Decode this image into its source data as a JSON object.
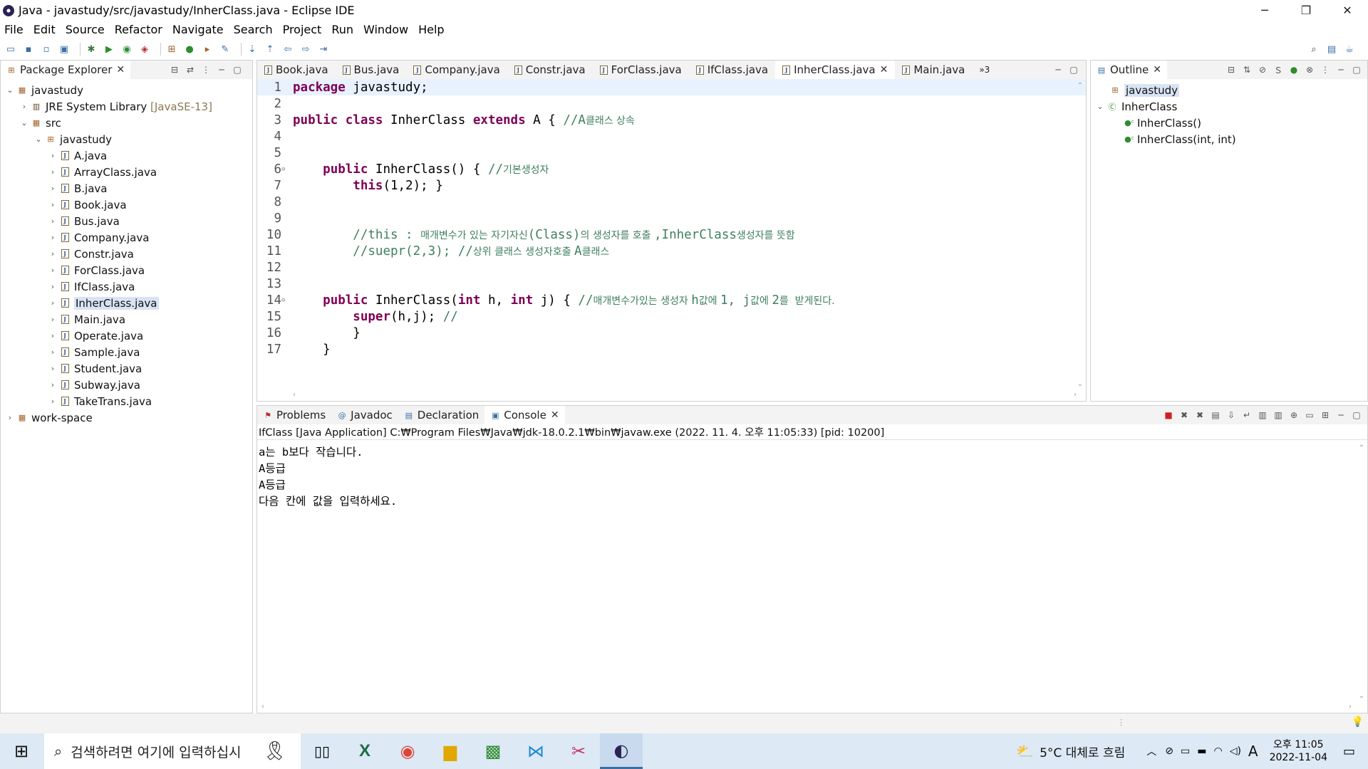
{
  "window": {
    "title": "Java - javastudy/src/javastudy/InherClass.java - Eclipse IDE",
    "minimize": "─",
    "restore": "❐",
    "close": "✕"
  },
  "menu": [
    "File",
    "Edit",
    "Source",
    "Refactor",
    "Navigate",
    "Search",
    "Project",
    "Run",
    "Window",
    "Help"
  ],
  "package_explorer": {
    "title": "Package Explorer",
    "project": "javastudy",
    "jre_label": "JRE System Library",
    "jre_version": "[JavaSE-13]",
    "src": "src",
    "package": "javastudy",
    "files": [
      "A.java",
      "ArrayClass.java",
      "B.java",
      "Book.java",
      "Bus.java",
      "Company.java",
      "Constr.java",
      "ForClass.java",
      "IfClass.java",
      "InherClass.java",
      "Main.java",
      "Operate.java",
      "Sample.java",
      "Student.java",
      "Subway.java",
      "TakeTrans.java"
    ],
    "selected_file": "InherClass.java",
    "other_project": "work-space"
  },
  "editor": {
    "tabs": [
      "Book.java",
      "Bus.java",
      "Company.java",
      "Constr.java",
      "ForClass.java",
      "IfClass.java",
      "InherClass.java",
      "Main.java"
    ],
    "active_tab": "InherClass.java",
    "overflow": "»3",
    "lines": [
      {
        "n": "1",
        "t": "package javastudy;"
      },
      {
        "n": "2",
        "t": ""
      },
      {
        "n": "3",
        "t": "public class InherClass extends A { //A클래스 상속"
      },
      {
        "n": "4",
        "t": ""
      },
      {
        "n": "5",
        "t": ""
      },
      {
        "n": "6",
        "t": "    public InherClass() { //기본생성자"
      },
      {
        "n": "7",
        "t": "        this(1,2); }"
      },
      {
        "n": "8",
        "t": ""
      },
      {
        "n": "9",
        "t": ""
      },
      {
        "n": "10",
        "t": "        //this : 매개변수가 있는 자기자신(Class)의 생성자를 호출 ,InherClass생성자를 뜻함"
      },
      {
        "n": "11",
        "t": "        //suepr(2,3); //상위 클래스 생성자호출 A클래스"
      },
      {
        "n": "12",
        "t": ""
      },
      {
        "n": "13",
        "t": ""
      },
      {
        "n": "14",
        "t": "    public InherClass(int h, int j) { //매개변수가있는 생성자 h값에 1, j값에 2를  받게된다."
      },
      {
        "n": "15",
        "t": "        super(h,j); //"
      },
      {
        "n": "16",
        "t": "        }"
      },
      {
        "n": "17",
        "t": "    }"
      }
    ]
  },
  "outline": {
    "title": "Outline",
    "package": "javastudy",
    "class": "InherClass",
    "members": [
      "InherClass()",
      "InherClass(int, int)"
    ]
  },
  "bottom": {
    "tabs": [
      "Problems",
      "Javadoc",
      "Declaration",
      "Console"
    ],
    "active": "Console",
    "header": "IfClass [Java Application] C:₩Program Files₩Java₩jdk-18.0.2.1₩bin₩javaw.exe  (2022. 11. 4. 오후 11:05:33) [pid: 10200]",
    "output": [
      "a는 b보다 작습니다.",
      "A등급",
      "A등급",
      "다음 칸에 값을 입력하세요."
    ]
  },
  "taskbar": {
    "search_placeholder": "검색하려면 여기에 입력하십시",
    "weather": "5°C  대체로 흐림",
    "ime": "A",
    "time": "오후 11:05",
    "date": "2022-11-04"
  }
}
